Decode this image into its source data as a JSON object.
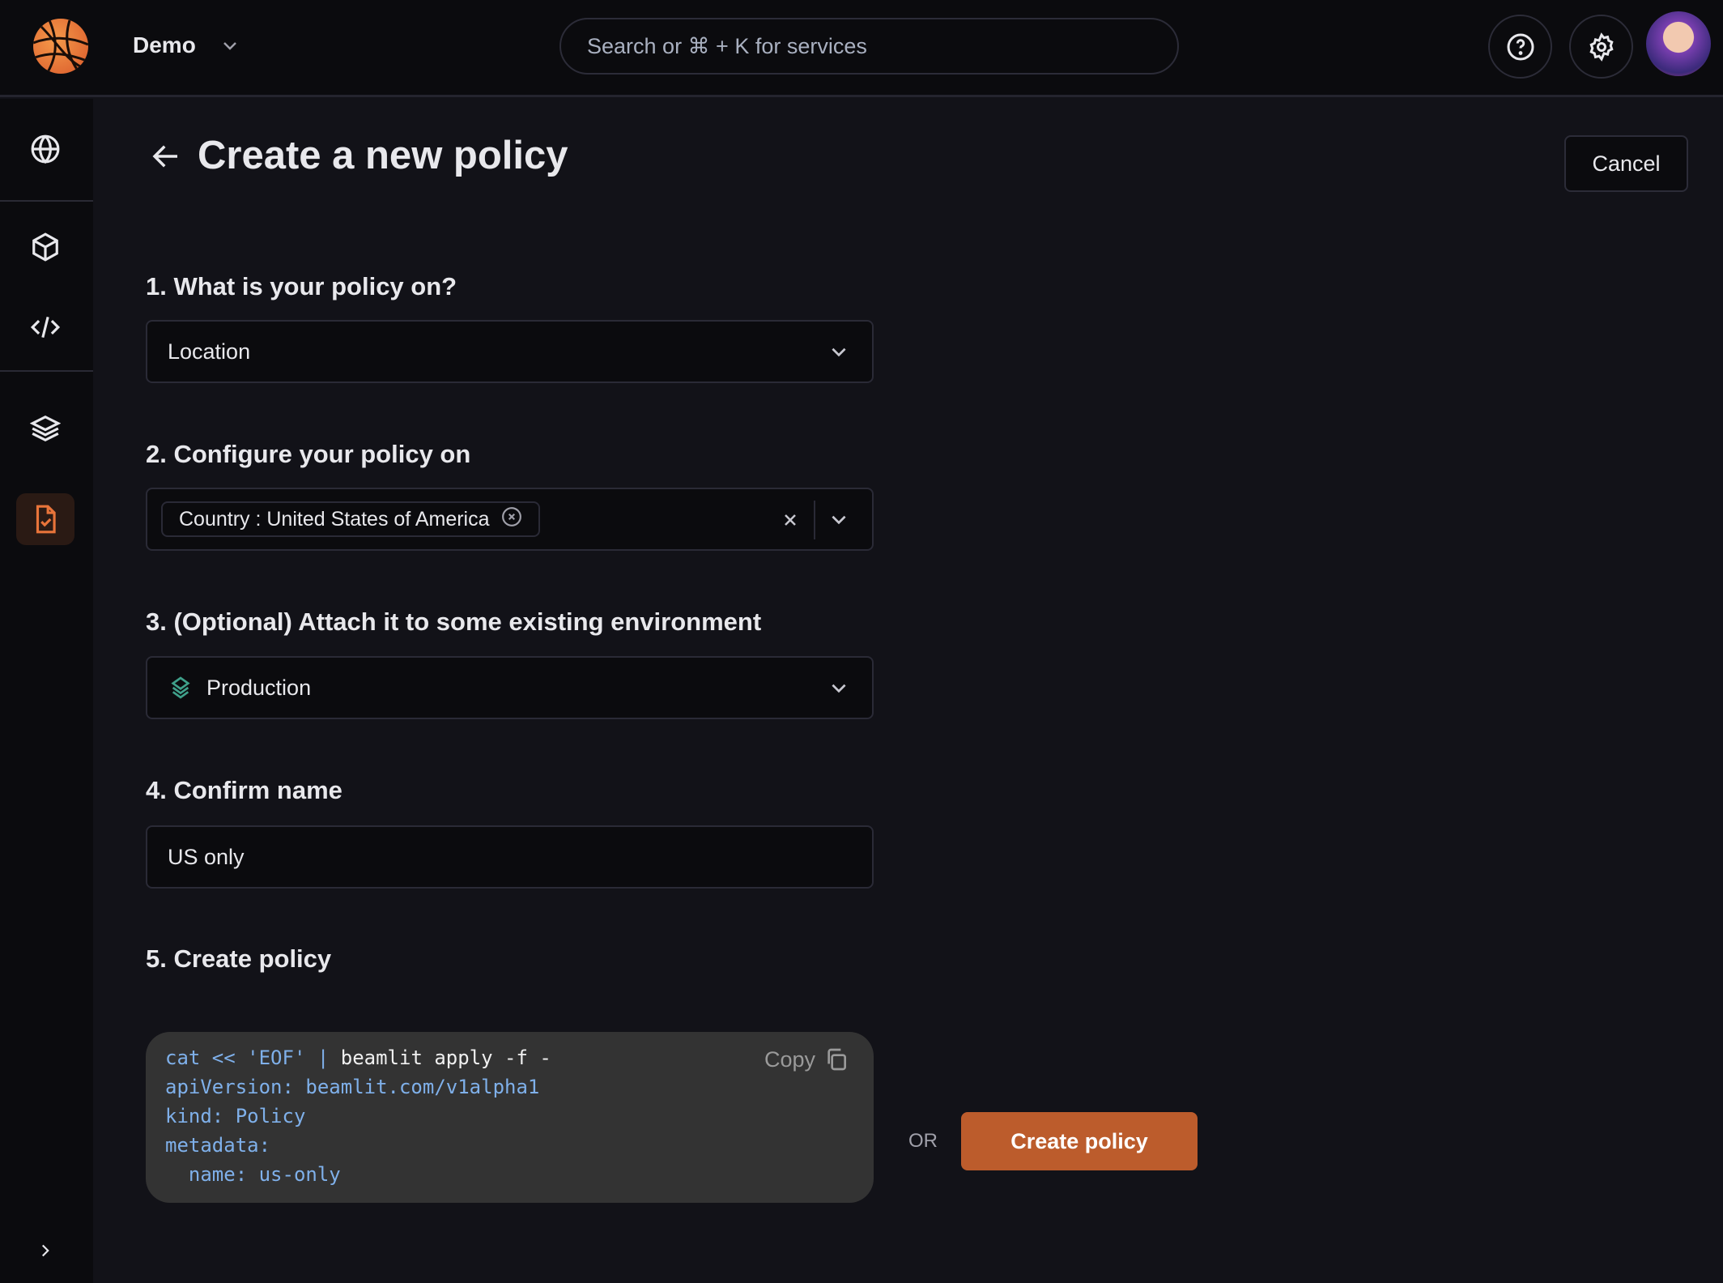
{
  "topbar": {
    "workspace": "Demo",
    "search_placeholder": "Search or ⌘ + K for services"
  },
  "sidebar": {
    "items": [
      {
        "icon": "globe-icon"
      },
      {
        "icon": "cube-icon"
      },
      {
        "icon": "code-icon"
      },
      {
        "icon": "layers-icon"
      },
      {
        "icon": "policy-icon",
        "active": true
      }
    ]
  },
  "page": {
    "title": "Create a new policy",
    "cancel_label": "Cancel"
  },
  "steps": {
    "s1": {
      "label": "1. What is your policy on?",
      "value": "Location"
    },
    "s2": {
      "label": "2. Configure your policy on",
      "chip": "Country : United States of America"
    },
    "s3": {
      "label": "3. (Optional) Attach it to some existing environment",
      "value": "Production"
    },
    "s4": {
      "label": "4. Confirm name",
      "value": "US only"
    },
    "s5": {
      "label": "5. Create policy"
    }
  },
  "code": {
    "copy_label": "Copy",
    "line1a": "cat << 'EOF' | ",
    "line1b": "beamlit apply -f -",
    "lines": [
      "apiVersion: beamlit.com/v1alpha1",
      "kind: Policy",
      "metadata:",
      "  name: us-only"
    ]
  },
  "actions": {
    "or_label": "OR",
    "create_label": "Create policy"
  },
  "colors": {
    "accent": "#bc5c2c",
    "code_blue": "#7fb0ea",
    "env_icon": "#3fa08a"
  }
}
